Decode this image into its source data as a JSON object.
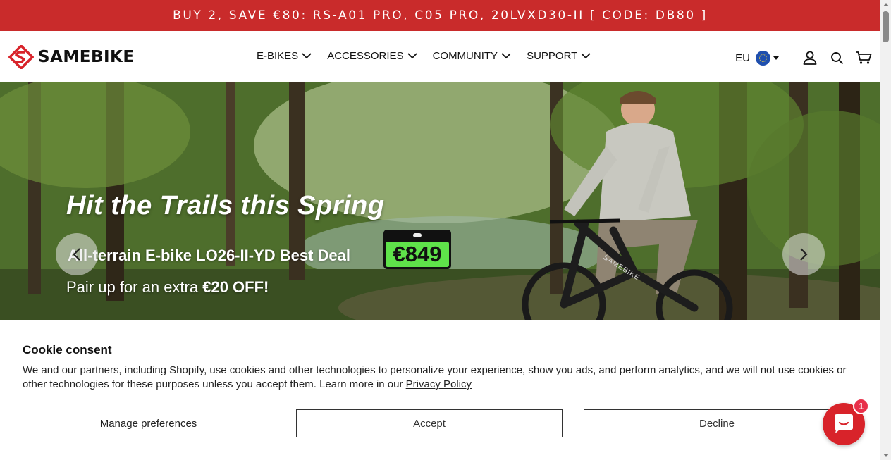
{
  "announcement": {
    "text": "BUY 2, SAVE €80: RS-A01 PRO, C05 PRO, 20LVXD30-II [ CODE: DB80 ]"
  },
  "header": {
    "logo_text": "SAMEBIKE",
    "nav": [
      {
        "label": "E-BIKES"
      },
      {
        "label": "ACCESSORIES"
      },
      {
        "label": "COMMUNITY"
      },
      {
        "label": "SUPPORT"
      }
    ],
    "region": "EU",
    "icons": [
      "eu-flag-icon",
      "account-icon",
      "search-icon",
      "cart-icon"
    ]
  },
  "hero": {
    "title": "Hit the Trails this Spring",
    "line2": "All-terrain E-bike LO26-II-YD Best Deal",
    "price": "€849",
    "line3_prefix": "Pair up for an extra ",
    "line3_bold": "€20 OFF!",
    "bike_brand": "SAMEBIKE"
  },
  "cookie": {
    "title": "Cookie consent",
    "text": "We and our partners, including Shopify, use cookies and other technologies to personalize your experience, show you ads, and perform analytics, and we will not use cookies or other technologies for these purposes unless you accept them. Learn more in our ",
    "link": "Privacy Policy",
    "manage": "Manage preferences",
    "accept": "Accept",
    "decline": "Decline"
  },
  "chat": {
    "badge": "1"
  },
  "colors": {
    "brand_red": "#c92b2b",
    "chat_red": "#d8232a",
    "price_green": "#5fe34a"
  }
}
